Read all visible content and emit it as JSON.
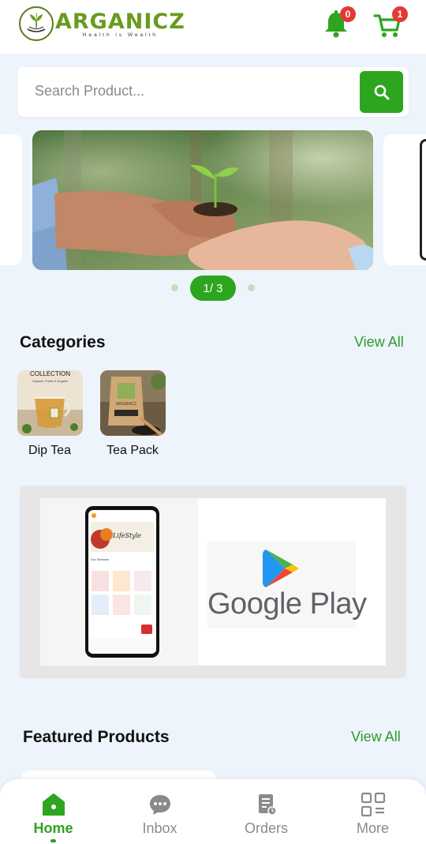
{
  "header": {
    "brand": "ARGANICZ",
    "tagline": "Health is Wealth",
    "notification_count": "0",
    "cart_count": "1"
  },
  "search": {
    "placeholder": "Search Product..."
  },
  "carousel": {
    "pager_text": "1/ 3"
  },
  "categories": {
    "title": "Categories",
    "view_all": "View All",
    "items": [
      {
        "label": "Dip Tea",
        "image_caption": "COLLECTION",
        "image_subcaption": "Organic, Fresh & Organic"
      },
      {
        "label": "Tea Pack",
        "image_caption": "ARGANICZ"
      }
    ]
  },
  "promo": {
    "store_label": "Google Play",
    "phone_headline": "LifeStyle",
    "phone_section": "Our Services"
  },
  "featured": {
    "title": "Featured Products",
    "view_all": "View All"
  },
  "nav": {
    "items": [
      {
        "label": "Home",
        "icon": "home-icon"
      },
      {
        "label": "Inbox",
        "icon": "chat-icon"
      },
      {
        "label": "Orders",
        "icon": "orders-icon"
      },
      {
        "label": "More",
        "icon": "grid-icon"
      }
    ]
  },
  "colors": {
    "accent": "#2ea51e",
    "badge": "#e53935",
    "brand": "#6a9a1f"
  }
}
